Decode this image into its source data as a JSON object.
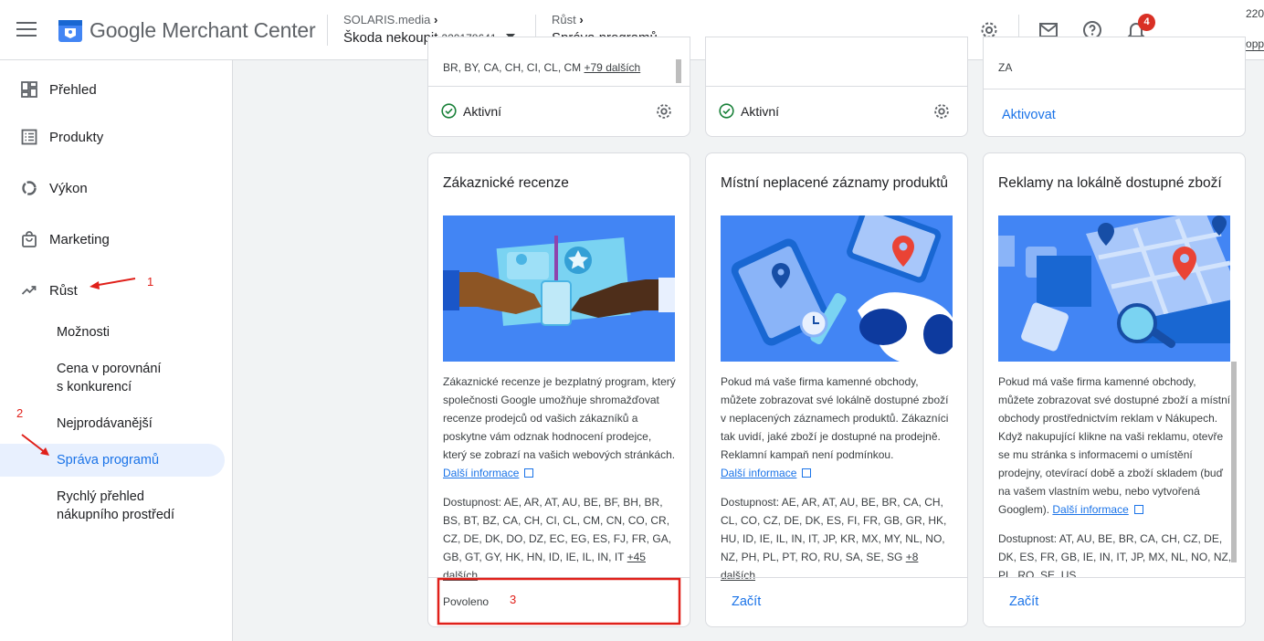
{
  "header": {
    "brand": "Google Merchant Center",
    "account_parent": "SOLARIS.media",
    "account_name": "Škoda nekoupit",
    "account_id": "220178641",
    "crumb_parent": "Růst",
    "crumb_current": "Správa programů",
    "notification_count": "4",
    "right_top": "220",
    "right_bottom": "CSS: Google Shoppi"
  },
  "sidebar": {
    "items": [
      {
        "label": "Přehled",
        "icon": "dashboard-icon"
      },
      {
        "label": "Produkty",
        "icon": "list-icon"
      },
      {
        "label": "Výkon",
        "icon": "donut-chart-icon"
      },
      {
        "label": "Marketing",
        "icon": "shopping-bag-icon"
      },
      {
        "label": "Růst",
        "icon": "trending-up-icon"
      }
    ],
    "sub_items": [
      {
        "label": "Možnosti"
      },
      {
        "label": "Cena v porovnání\ns konkurencí"
      },
      {
        "label": "Nejprodávanější"
      },
      {
        "label": "Správa programů"
      },
      {
        "label": "Rychlý přehled\nnákupního prostředí"
      }
    ]
  },
  "top_cards": {
    "card1_avail_tail": "BR, BY, CA, CH, CI, CL, CM",
    "card1_more": "+79 dalších",
    "card1_status": "Aktivní",
    "card2_status": "Aktivní",
    "card3_avail_tail": "ZA",
    "card3_action": "Aktivovat"
  },
  "programs": [
    {
      "title": "Zákaznické recenze",
      "description": "Zákaznické recenze je bezplatný program, který společnosti Google umožňuje shromažďovat recenze prodejců od vašich zákazníků a poskytne vám odznak hodnocení prodejce, který se zobrazí na vašich webových stránkách.",
      "link": "Další informace",
      "availability": "Dostupnost: AE, AR, AT, AU, BE, BF, BH, BR, BS, BT, BZ, CA, CH, CI, CL, CM, CN, CO, CR, CZ, DE, DK, DO, DZ, EC, EG, ES, FJ, FR, GA, GB, GT, GY, HK, HN, ID, IE, IL, IN, IT",
      "more": "+45 dalších",
      "footer": "Povoleno"
    },
    {
      "title": "Místní neplacené záznamy produktů",
      "description": "Pokud má vaše firma kamenné obchody, můžete zobrazovat své lokálně dostupné zboží v neplacených záznamech produktů. Zákazníci tak uvidí, jaké zboží je dostupné na prodejně. Reklamní kampaň není podmínkou.",
      "link": "Další informace",
      "availability": "Dostupnost: AE, AR, AT, AU, BE, BR, CA, CH, CL, CO, CZ, DE, DK, ES, FI, FR, GB, GR, HK, HU, ID, IE, IL, IN, IT, JP, KR, MX, MY, NL, NO, NZ, PH, PL, PT, RO, RU, SA, SE, SG",
      "more": "+8 dalších",
      "footer": "Začít"
    },
    {
      "title": "Reklamy na lokálně dostupné zboží",
      "description": "Pokud má vaše firma kamenné obchody, můžete zobrazovat své dostupné zboží a místní obchody prostřednictvím reklam v Nákupech. Když nakupující klikne na vaši reklamu, otevře se mu stránka s informacemi o umístění prodejny, otevírací době a zboží skladem (buď na vašem vlastním webu, nebo vytvořená Googlem).",
      "link": "Další informace",
      "availability": "Dostupnost: AT, AU, BE, BR, CA, CH, CZ, DE, DK, ES, FR, GB, IE, IN, IT, JP, MX, NL, NO, NZ, PL, RO, SE, US",
      "footer": "Začít"
    }
  ],
  "annotations": [
    "1",
    "2",
    "3"
  ],
  "colors": {
    "accent": "#1a73e8",
    "active_bg": "#e8f0fe",
    "success": "#188038",
    "annotation": "#e0201a"
  }
}
